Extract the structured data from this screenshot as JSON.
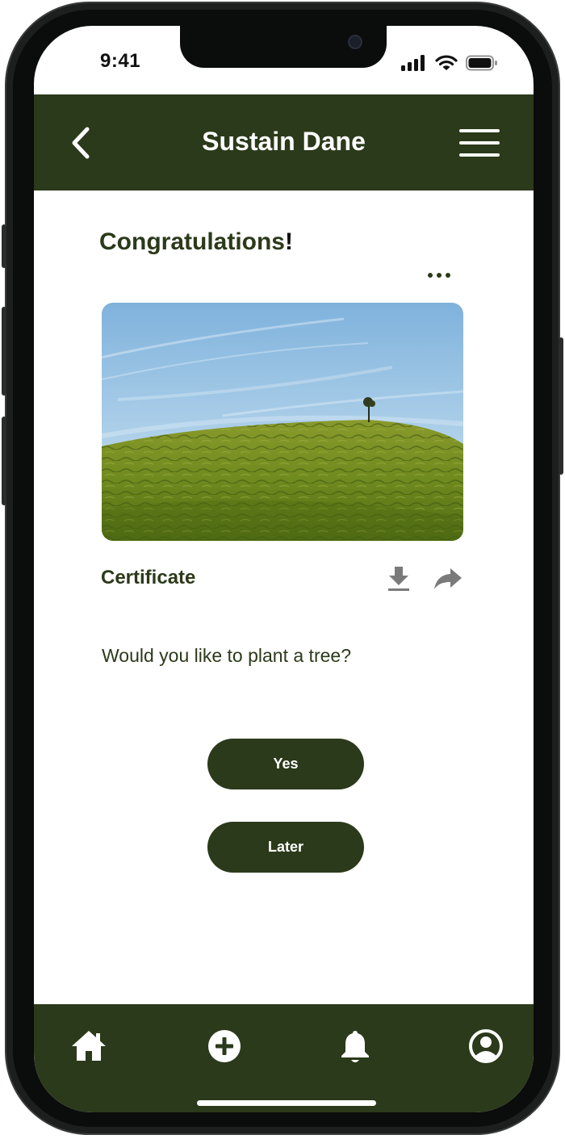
{
  "status_bar": {
    "time": "9:41"
  },
  "app_bar": {
    "title": "Sustain Dane"
  },
  "content": {
    "heading": "Congratulations",
    "heading_punct": "!",
    "image_alt": "Green tea hill with a lone tree under blue sky",
    "certificate_label": "Certificate",
    "question": "Would you like to plant a tree?"
  },
  "buttons": {
    "yes": "Yes",
    "later": "Later"
  },
  "tabs": [
    "home",
    "add",
    "notifications",
    "profile"
  ],
  "colors": {
    "primary": "#2b3a1a",
    "background": "#ffffff"
  }
}
